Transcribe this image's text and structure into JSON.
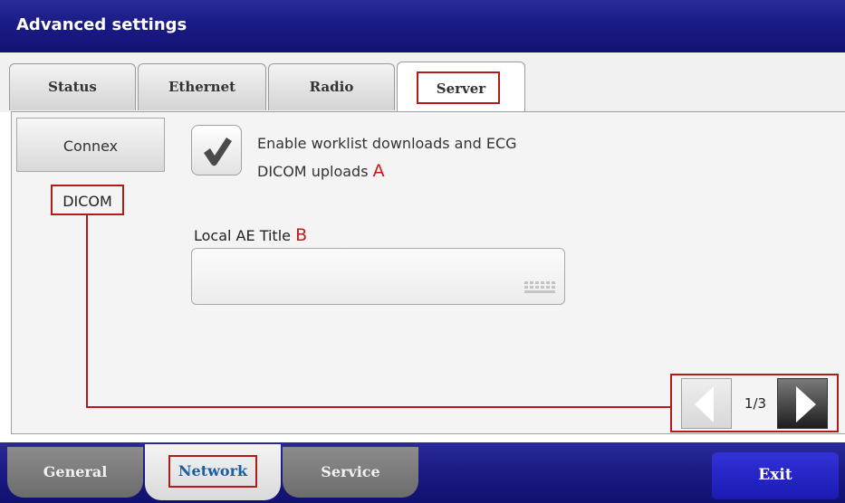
{
  "window": {
    "title": "Advanced settings"
  },
  "top_tabs": [
    {
      "label": "Status"
    },
    {
      "label": "Ethernet"
    },
    {
      "label": "Radio"
    },
    {
      "label": "Server",
      "active": true
    }
  ],
  "sidebar": {
    "items": [
      {
        "label": "Connex"
      },
      {
        "label": "DICOM",
        "selected": true
      }
    ]
  },
  "dicom_enable": {
    "checked": true,
    "label_line1": "Enable worklist downloads and ECG",
    "label_line2": "DICOM uploads",
    "callout": "A"
  },
  "local_ae_title": {
    "label": "Local AE Title",
    "callout": "B",
    "value": "",
    "keyboard_icon": "keyboard-icon"
  },
  "pager": {
    "indicator": "1/3"
  },
  "bottom_tabs": [
    {
      "label": "General"
    },
    {
      "label": "Network",
      "active": true
    },
    {
      "label": "Service"
    }
  ],
  "exit_button": {
    "label": "Exit"
  },
  "colors": {
    "title_bar": "#1b1b86",
    "accent": "#1a1ab2",
    "annotation": "#b31b1b",
    "active_bottom_tab_text": "#1c5fa0"
  }
}
